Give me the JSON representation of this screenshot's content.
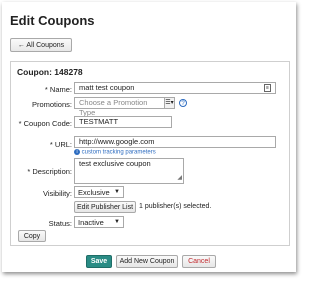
{
  "page": {
    "title": "Edit Coupons",
    "back_label": "← All Coupons"
  },
  "coupon": {
    "heading": "Coupon: 148278"
  },
  "form": {
    "name": {
      "label": "* Name:",
      "value": "matt test coupon"
    },
    "promotions": {
      "label": "Promotions:",
      "placeholder": "Choose a Promotion Type"
    },
    "coupon_code": {
      "label": "* Coupon Code:",
      "value": "TESTMATT"
    },
    "url": {
      "label": "* URL:",
      "value": "http://www.google.com",
      "link": "custom tracking parameters"
    },
    "description": {
      "label": "* Description:",
      "value": "test exclusive coupon"
    },
    "visibility": {
      "label": "Visibility:",
      "value": "Exclusive"
    },
    "publisher": {
      "button": "Edit Publisher List",
      "count_text": "1 publisher(s) selected."
    },
    "status": {
      "label": "Status:",
      "value": "Inactive"
    },
    "copy_label": "Copy"
  },
  "footer": {
    "save": "Save",
    "add_new": "Add New Coupon",
    "cancel": "Cancel"
  },
  "colors": {
    "save_bg": "#2a8c85",
    "cancel_text": "#c0282d",
    "link": "#2d6cc0"
  },
  "icons": {
    "name_field": "list-icon",
    "promotions_sel": "list-toggle-icon",
    "promotions_help": "help-icon",
    "url_info": "info-icon"
  }
}
